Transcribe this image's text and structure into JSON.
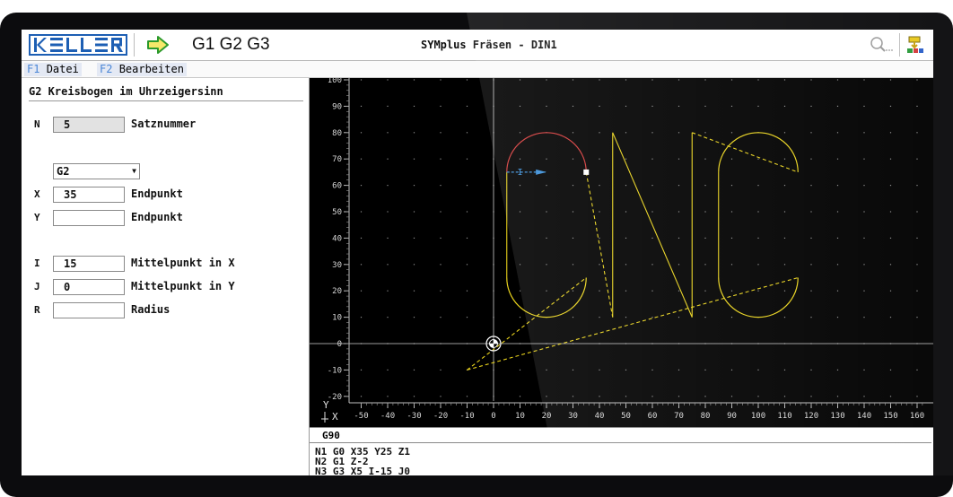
{
  "header": {
    "logo": "KELLER",
    "gcodes": "G1 G2 G3",
    "title": "SYMplus Fräsen - DIN1"
  },
  "menu": [
    {
      "key": "F1",
      "label": "Datei"
    },
    {
      "key": "F2",
      "label": "Bearbeiten"
    }
  ],
  "command": {
    "title": "G2 Kreisbogen im Uhrzeigersinn",
    "fields": [
      {
        "letter": "N",
        "value": "5",
        "desc": "Satznummer"
      },
      {
        "letter": "X",
        "value": "35",
        "desc": "Endpunkt"
      },
      {
        "letter": "Y",
        "value": "",
        "desc": "Endpunkt"
      },
      {
        "letter": "I",
        "value": "15",
        "desc": "Mittelpunkt in X"
      },
      {
        "letter": "J",
        "value": "0",
        "desc": "Mittelpunkt in Y"
      },
      {
        "letter": "R",
        "value": "",
        "desc": "Radius"
      }
    ],
    "gselect": "G2"
  },
  "graph": {
    "y_ticks": [
      "100",
      "90",
      "80",
      "70",
      "60",
      "50",
      "40",
      "30",
      "20",
      "10",
      "0",
      "-10",
      "-20"
    ],
    "x_ticks": [
      "-50",
      "-40",
      "-30",
      "-20",
      "-10",
      "0",
      "10",
      "20",
      "30",
      "40",
      "50",
      "60",
      "70",
      "80",
      "90",
      "100",
      "110",
      "120",
      "130",
      "140",
      "150",
      "160"
    ],
    "axis_label_y": "Y",
    "axis_label_x": "X",
    "ijk_label": "I",
    "colors": {
      "path": "#e8d21c",
      "arc": "#d23a3a",
      "marker": "#3a8fd9",
      "grid": "#8c8c8c"
    }
  },
  "code": {
    "header": "G90",
    "lines": [
      "N1 G0 X35 Y25 Z1",
      "N2 G1 Z-2",
      "N3 G3 X5 I-15 J0"
    ]
  }
}
